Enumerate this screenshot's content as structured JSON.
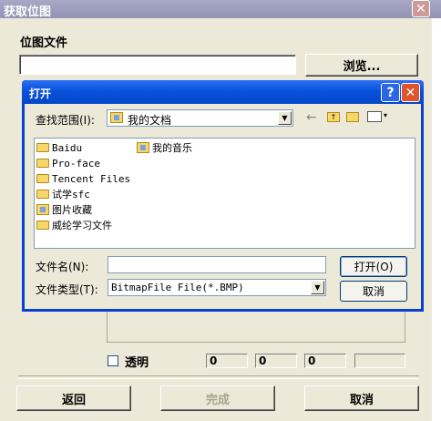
{
  "outer": {
    "title": "获取位图",
    "close_glyph": "✕",
    "bitmap_file_label": "位图文件",
    "bitmap_file_value": "",
    "browse_button": "浏览...",
    "transparent_label": "透明",
    "transparent_checked": false,
    "values": [
      "0",
      "0",
      "0",
      ""
    ],
    "back_button": "返回",
    "finish_button": "完成",
    "cancel_button": "取消"
  },
  "open_dialog": {
    "title": "打开",
    "help_glyph": "?",
    "close_glyph": "✕",
    "look_in_label": "查找范围(I):",
    "look_in_value": "我的文档",
    "toolbar": {
      "back_icon": "back-arrow-icon",
      "up_icon": "up-folder-icon",
      "new_folder_icon": "new-folder-icon",
      "view_menu_icon": "view-menu-icon"
    },
    "files": [
      {
        "name": "Baidu",
        "icon": "folder-icon"
      },
      {
        "name": "Pro-face",
        "icon": "folder-icon"
      },
      {
        "name": "Tencent Files",
        "icon": "folder-icon"
      },
      {
        "name": "试学sfc",
        "icon": "folder-icon"
      },
      {
        "name": "图片收藏",
        "icon": "pictures-folder-icon"
      },
      {
        "name": "威纶学习文件",
        "icon": "folder-icon"
      },
      {
        "name": "我的音乐",
        "icon": "music-folder-icon"
      }
    ],
    "filename_label": "文件名(N):",
    "filename_value": "",
    "filetype_label": "文件类型(T):",
    "filetype_value": "BitmapFile File(*.BMP)",
    "open_button": "打开(O)",
    "cancel_button": "取消"
  }
}
